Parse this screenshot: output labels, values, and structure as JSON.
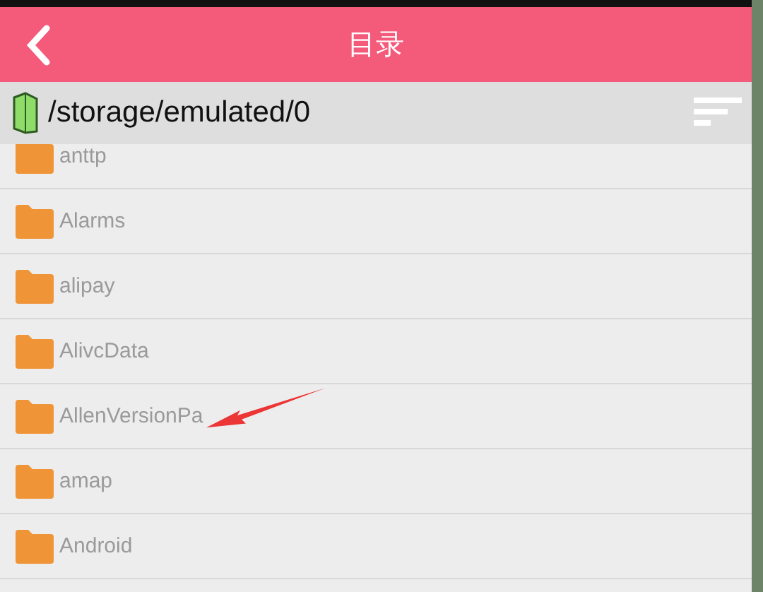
{
  "header": {
    "title": "目录"
  },
  "path_bar": {
    "path": "/storage/emulated/0"
  },
  "folders": [
    {
      "name": "anttp",
      "annotated": false
    },
    {
      "name": "Alarms",
      "annotated": false
    },
    {
      "name": "alipay",
      "annotated": false
    },
    {
      "name": "AlivcData",
      "annotated": false
    },
    {
      "name": "AllenVersionPa",
      "annotated": true
    },
    {
      "name": "amap",
      "annotated": false
    },
    {
      "name": "Android",
      "annotated": false
    }
  ]
}
